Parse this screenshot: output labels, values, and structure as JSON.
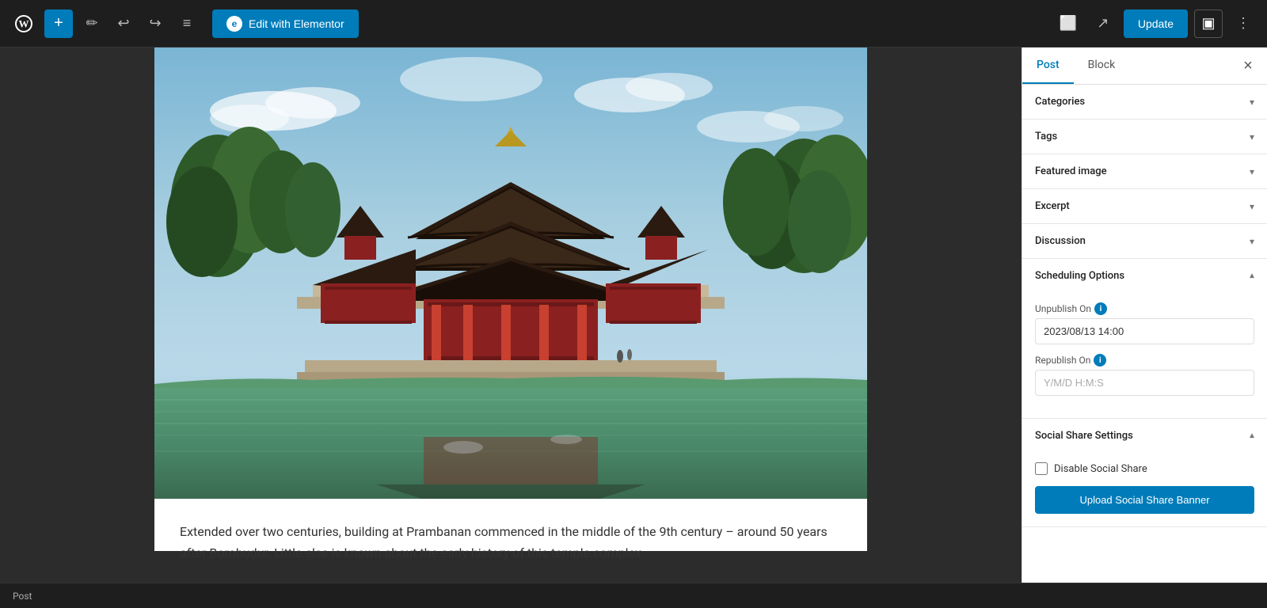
{
  "topbar": {
    "wp_logo": "W",
    "add_label": "+",
    "edit_icon": "✎",
    "undo_icon": "↩",
    "redo_icon": "↪",
    "list_icon": "≡",
    "elementor_label": "Edit with Elementor",
    "elementor_icon": "e",
    "view_icon": "⬜",
    "external_icon": "↗",
    "update_label": "Update",
    "sidebar_toggle_icon": "▣",
    "menu_icon": "⋮"
  },
  "sidebar": {
    "tab_post": "Post",
    "tab_block": "Block",
    "close_icon": "×",
    "panels": {
      "categories": {
        "title": "Categories",
        "collapsed": true
      },
      "tags": {
        "title": "Tags",
        "collapsed": true
      },
      "featured_image": {
        "title": "Featured image",
        "collapsed": true
      },
      "excerpt": {
        "title": "Excerpt",
        "collapsed": true
      },
      "discussion": {
        "title": "Discussion",
        "collapsed": true
      },
      "scheduling_options": {
        "title": "Scheduling Options",
        "expanded": true,
        "unpublish_on_label": "Unpublish On",
        "unpublish_on_value": "2023/08/13 14:00",
        "republish_on_label": "Republish On",
        "republish_on_placeholder": "Y/M/D H:M:S"
      },
      "social_share_settings": {
        "title": "Social Share Settings",
        "expanded": true,
        "disable_social_share_label": "Disable Social Share",
        "disable_social_share_checked": false,
        "upload_banner_label": "Upload Social Share Banner"
      }
    }
  },
  "content": {
    "post_text": "Extended over two centuries, building at Prambanan commenced in the middle of the 9th century – around 50 years after Borobudur. Little else is known about the early history of this temple complex"
  },
  "status_bar": {
    "label": "Post"
  }
}
